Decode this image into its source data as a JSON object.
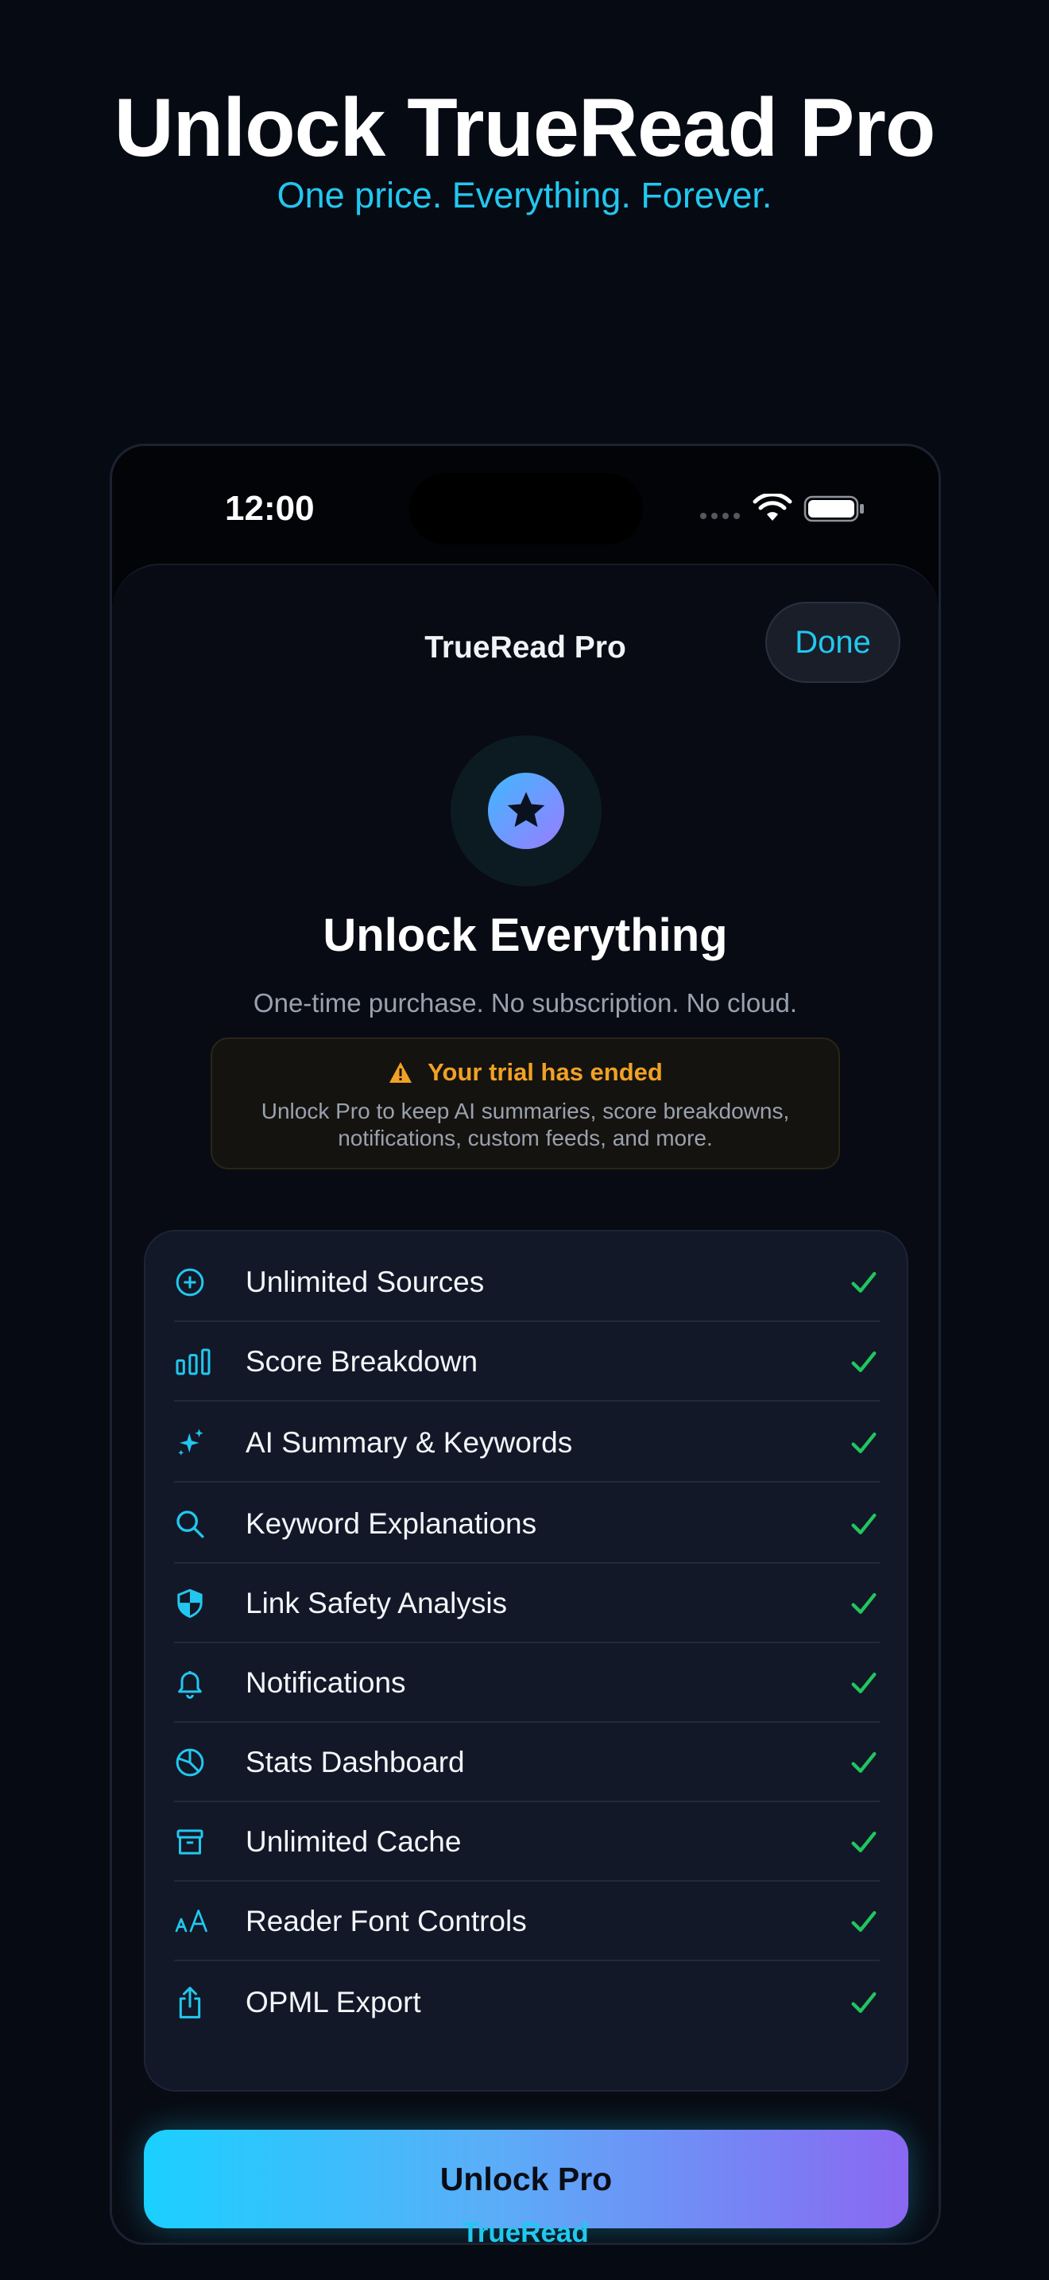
{
  "hero": {
    "title": "Unlock TrueRead Pro",
    "subtitle": "One price. Everything. Forever."
  },
  "status_bar": {
    "time": "12:00"
  },
  "sheet": {
    "title": "TrueRead Pro",
    "done_label": "Done",
    "heading": "Unlock Everything",
    "subheading": "One-time purchase. No subscription. No cloud.",
    "badge_icon": "star-icon"
  },
  "trial": {
    "title": "Your trial has ended",
    "body": "Unlock Pro to keep AI summaries, score breakdowns, notifications, custom feeds, and more.",
    "icon": "warning-icon"
  },
  "features": [
    {
      "label": "Unlimited Sources",
      "icon": "plus-circle-icon",
      "included": true
    },
    {
      "label": "Score Breakdown",
      "icon": "bar-chart-icon",
      "included": true
    },
    {
      "label": "AI Summary & Keywords",
      "icon": "sparkles-icon",
      "included": true
    },
    {
      "label": "Keyword Explanations",
      "icon": "magnifier-icon",
      "included": true
    },
    {
      "label": "Link Safety Analysis",
      "icon": "shield-icon",
      "included": true
    },
    {
      "label": "Notifications",
      "icon": "bell-icon",
      "included": true
    },
    {
      "label": "Stats Dashboard",
      "icon": "pie-chart-icon",
      "included": true
    },
    {
      "label": "Unlimited Cache",
      "icon": "archive-box-icon",
      "included": true
    },
    {
      "label": "Reader Font Controls",
      "icon": "text-size-icon",
      "included": true
    },
    {
      "label": "OPML Export",
      "icon": "share-icon",
      "included": true
    }
  ],
  "cta": {
    "label": "Unlock Pro"
  },
  "footer": {
    "brand": "TrueRead"
  },
  "colors": {
    "accent": "#22c7ef",
    "check": "#22c55e",
    "warning": "#f0a126",
    "background": "#060a13"
  }
}
